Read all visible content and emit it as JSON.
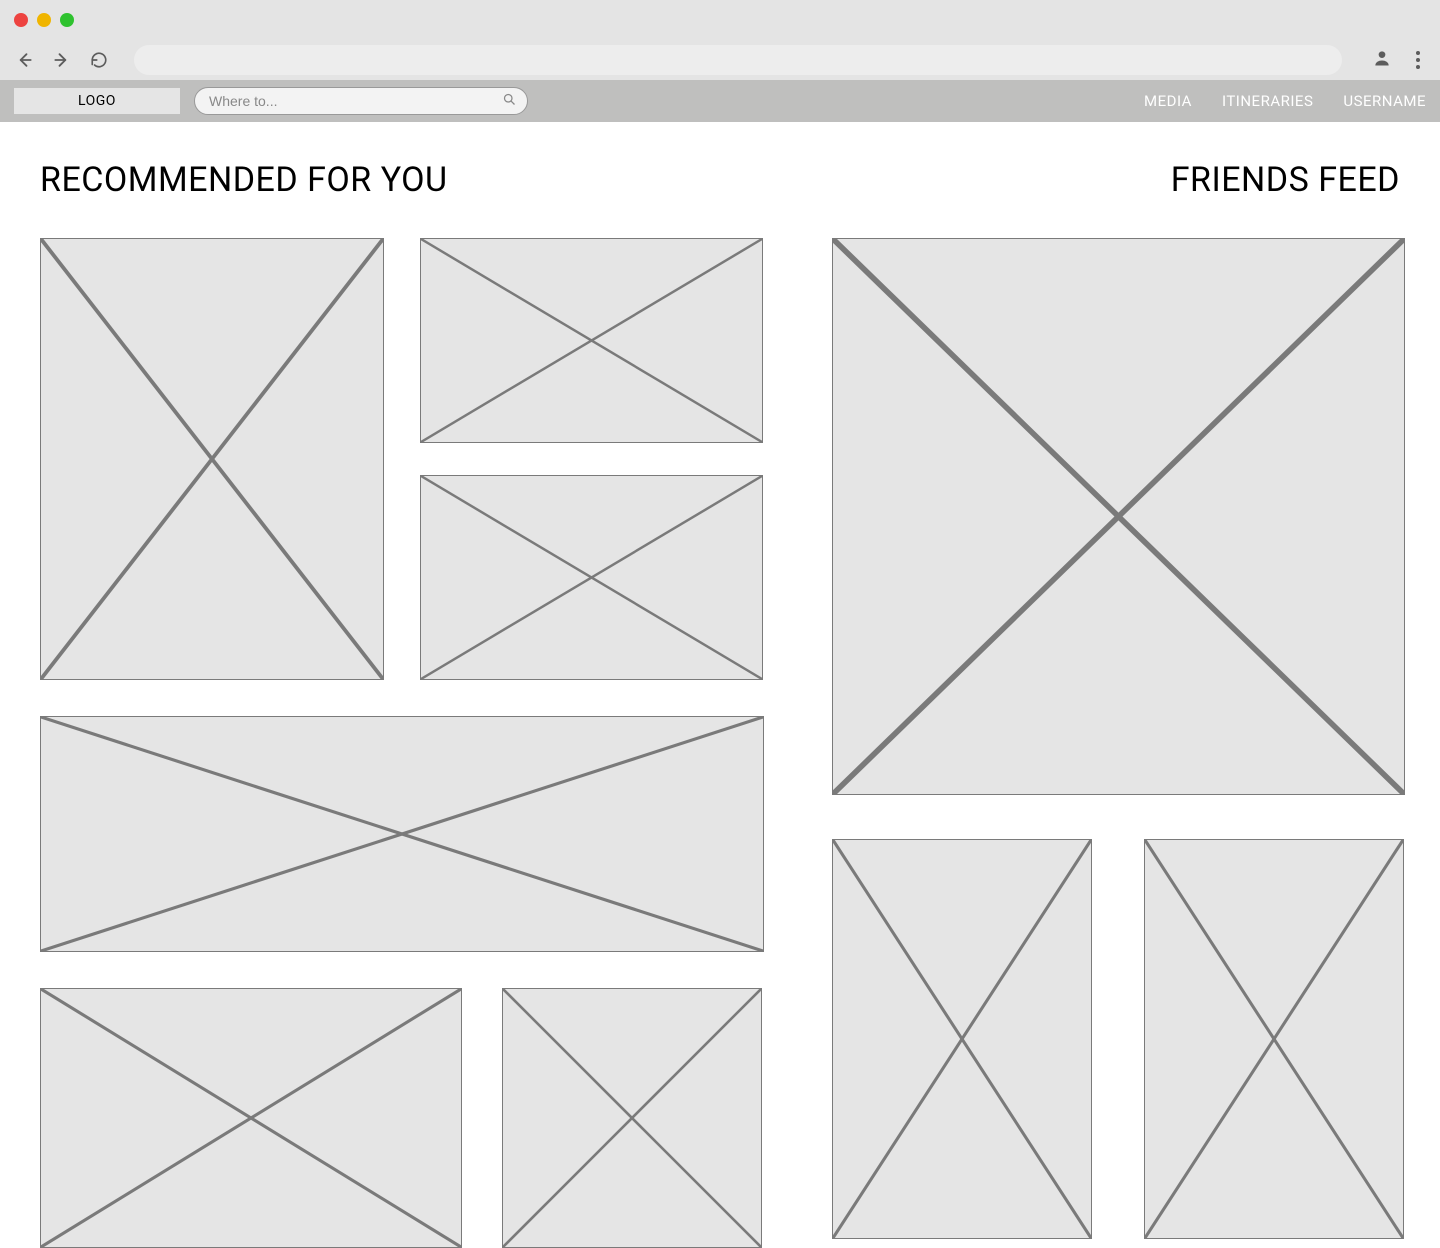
{
  "navbar": {
    "logo": "LOGO",
    "search_placeholder": "Where to...",
    "links": [
      "MEDIA",
      "ITINERARIES",
      "USERNAME"
    ]
  },
  "sections": {
    "recommended": "RECOMMENDED FOR YOU",
    "friends": "FRIENDS FEED"
  }
}
